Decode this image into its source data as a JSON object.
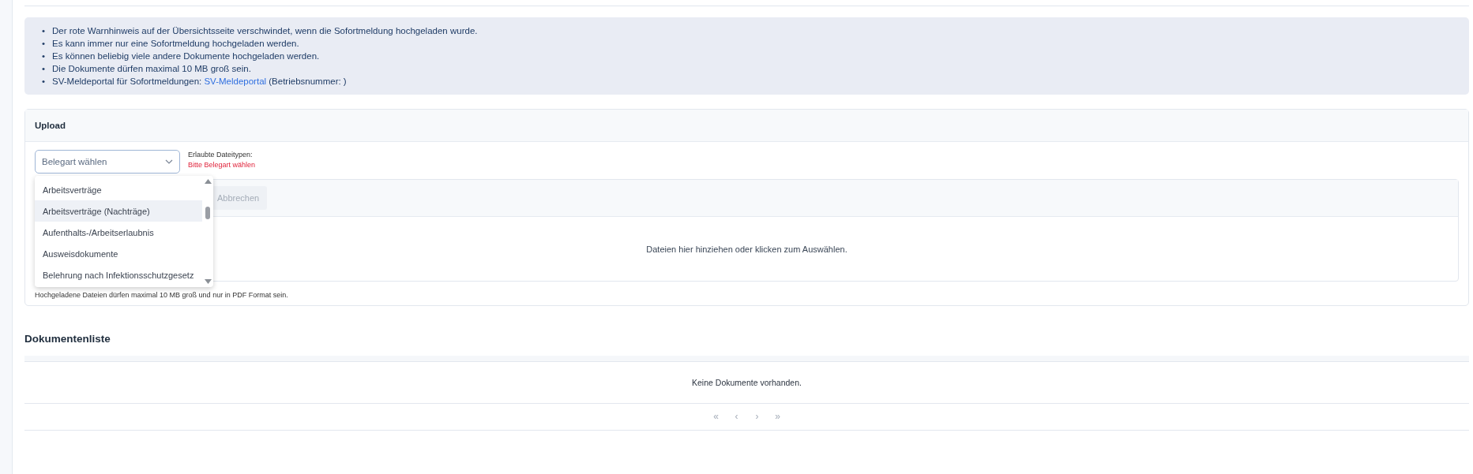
{
  "notices": [
    {
      "bullet": "•",
      "text": "Der rote Warnhinweis auf der Übersichtsseite verschwindet, wenn die Sofortmeldung hochgeladen wurde."
    },
    {
      "bullet": "•",
      "text": "Es kann immer nur eine Sofortmeldung hochgeladen werden."
    },
    {
      "bullet": "•",
      "text": "Es können beliebig viele andere Dokumente hochgeladen werden."
    },
    {
      "bullet": "•",
      "text": "Die Dokumente dürfen maximal 10 MB groß sein."
    },
    {
      "bullet": "•",
      "text": "SV-Meldeportal für Sofortmeldungen:",
      "link": "SV-Meldeportal",
      "after": "(Betriebsnummer: )"
    }
  ],
  "upload": {
    "title": "Upload",
    "select": {
      "placeholder": "Belegart wählen",
      "expanded": true
    },
    "allowed_types": {
      "label": "Erlaubte Dateitypen:",
      "value": "Bitte Belegart wählen"
    },
    "options": [
      {
        "label": "Arbeitsverträge",
        "selected": false
      },
      {
        "label": "Arbeitsverträge (Nachträge)",
        "selected": true
      },
      {
        "label": "Aufenthalts-/Arbeitserlaubnis",
        "selected": false
      },
      {
        "label": "Ausweisdokumente",
        "selected": false
      },
      {
        "label": "Belehrung nach Infektionsschutzgesetz",
        "selected": false
      }
    ],
    "cancel_button": "Abbrechen",
    "dropzone": "Dateien hier hinziehen oder klicken zum Auswählen.",
    "hint": "Hochgeladene Dateien dürfen maximal 10 MB groß und nur in PDF Format sein."
  },
  "documents": {
    "title": "Dokumentenliste",
    "empty": "Keine Dokumente vorhanden.",
    "pagination": [
      "«",
      "‹",
      "›",
      "»"
    ]
  }
}
